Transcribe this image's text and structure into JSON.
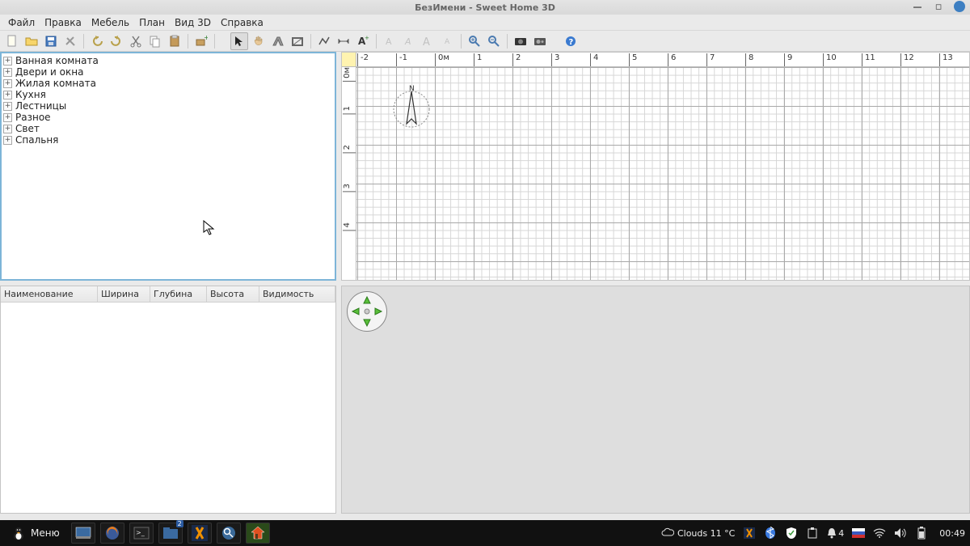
{
  "window": {
    "title": "БезИмени - Sweet Home 3D"
  },
  "menus": [
    "Файл",
    "Правка",
    "Мебель",
    "План",
    "Вид 3D",
    "Справка"
  ],
  "catalog": {
    "items": [
      "Ванная комната",
      "Двери и окна",
      "Жилая комната",
      "Кухня",
      "Лестницы",
      "Разное",
      "Свет",
      "Спальня"
    ]
  },
  "furniture_table": {
    "columns": [
      "Наименование",
      "Ширина",
      "Глубина",
      "Высота",
      "Видимость"
    ]
  },
  "ruler": {
    "h_labels": [
      "-2",
      "-1",
      "0м",
      "1",
      "2",
      "3",
      "4",
      "5",
      "6",
      "7",
      "8",
      "9",
      "10",
      "11",
      "12",
      "13"
    ],
    "v_labels": [
      "0м",
      "1",
      "2",
      "3",
      "4"
    ],
    "compass_n": "N"
  },
  "taskbar": {
    "menu_label": "Меню",
    "weather": "Clouds 11 °C",
    "notifications": "4",
    "clock": "00:49"
  }
}
